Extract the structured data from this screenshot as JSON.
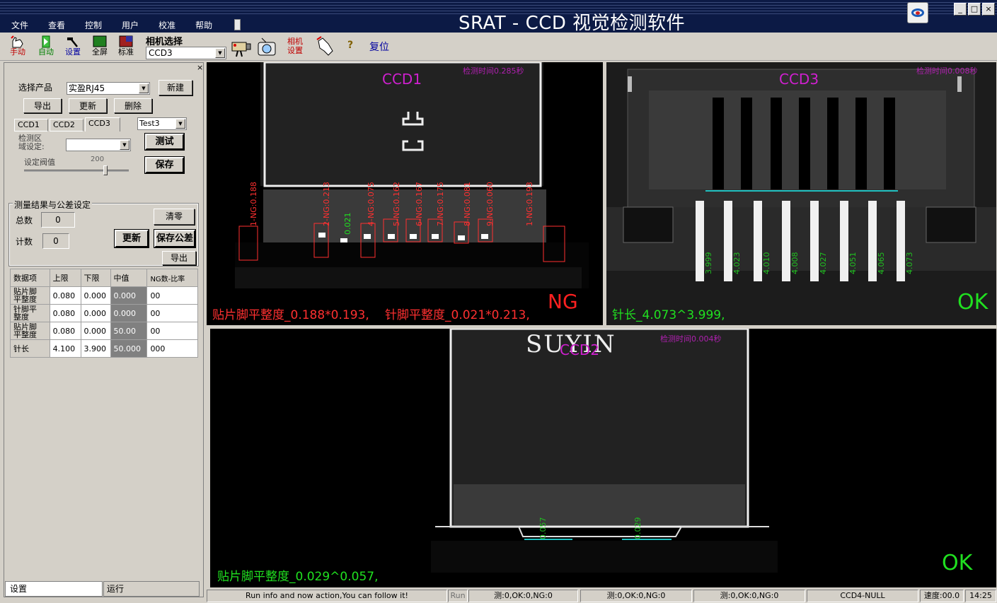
{
  "app": {
    "title": "SRAT - CCD 视觉检测软件",
    "menu": [
      "文件",
      "查看",
      "控制",
      "用户",
      "校准",
      "帮助"
    ],
    "window_buttons": [
      "_",
      "□",
      "×"
    ]
  },
  "toolbar": {
    "manual": "手动",
    "auto": "自动",
    "settings": "设置",
    "fullscreen": "全屏",
    "standard": "标准",
    "camera_select_label": "相机选择",
    "camera_select_value": "CCD3",
    "camera_settings": "相机设置",
    "help": "?",
    "reset": "复位"
  },
  "left_panel": {
    "product_label": "选择产品",
    "product_value": "实盈RJ45",
    "new_button": "新建",
    "export_button": "导出",
    "update_button": "更新",
    "delete_button": "删除",
    "tabs": [
      "CCD1",
      "CCD2",
      "CCD3"
    ],
    "active_tab": "CCD3",
    "test_select": "Test3",
    "region_label_1": "检测区",
    "region_label_2": "域设定:",
    "region_value": "",
    "test_button": "测试",
    "threshold_label": "设定阀值",
    "threshold_value": "200",
    "save_button": "保存",
    "group_title": "测量结果与公差设定",
    "total_label": "总数",
    "total_value": "0",
    "count_label": "计数",
    "count_value": "0",
    "clear_button": "清零",
    "update_bold_button": "更新",
    "save_tolerance_button": "保存公差",
    "export_button_2": "导出",
    "grid": {
      "headers": [
        "数据项",
        "上限",
        "下限",
        "中值",
        "NG数-比率"
      ],
      "rows": [
        {
          "name_1": "贴片脚",
          "name_2": "平整度",
          "upper": "0.080",
          "lower": "0.000",
          "mid": "0.000",
          "ng": "00"
        },
        {
          "name_1": "针脚平",
          "name_2": "整度",
          "upper": "0.080",
          "lower": "0.000",
          "mid": "0.000",
          "ng": "00"
        },
        {
          "name_1": "贴片脚",
          "name_2": "平整度",
          "upper": "0.080",
          "lower": "0.000",
          "mid": "50.00",
          "ng": "00"
        },
        {
          "name_1": "针长",
          "name_2": "",
          "upper": "4.100",
          "lower": "3.900",
          "mid": "50.000",
          "ng": "000"
        }
      ]
    },
    "bottom_tabs": [
      "设置",
      "运行"
    ]
  },
  "views": {
    "ccd1": {
      "title": "CCD1",
      "time": "检测时间0.285秒",
      "result": "NG",
      "summary_a": "贴片脚平整度_0.188*0.193,",
      "summary_b": "针脚平整度_0.021*0.213,",
      "labels": [
        "1-NG:0.188",
        "2-NG:0.213",
        "0.021",
        "4-NG:0.075",
        "5-NG:0.162",
        "6-NG:0.167",
        "7-NG:0.175",
        "8-NG:0.081",
        "9-NG:0.060",
        "1-NG:0.193"
      ],
      "color_ng": "#ff3030",
      "color_ok": "#20e020"
    },
    "ccd3": {
      "title": "CCD3",
      "time": "检测时间0.008秒",
      "result": "OK",
      "summary": "针长_4.073^3.999,",
      "pin_labels": [
        "3.999",
        "4.023",
        "4.010",
        "4.008",
        "4.027",
        "4.051",
        "4.065",
        "4.073"
      ]
    },
    "ccd2": {
      "title": "CCD2",
      "time": "检测时间0.004秒",
      "result": "OK",
      "stamp": "SUYIN",
      "summary": "贴片脚平整度_0.029^0.057,",
      "pin_labels": [
        "0.057",
        "0.029"
      ]
    }
  },
  "statusbar": {
    "message": "Run info and now action,You can follow it!",
    "mode": "Run",
    "cell1": "测:0,OK:0,NG:0",
    "cell2": "测:0,OK:0,NG:0",
    "cell3": "测:0,OK:0,NG:0",
    "cell4": "CCD4-NULL",
    "speed": "速度:00.0",
    "time": "14:25"
  }
}
